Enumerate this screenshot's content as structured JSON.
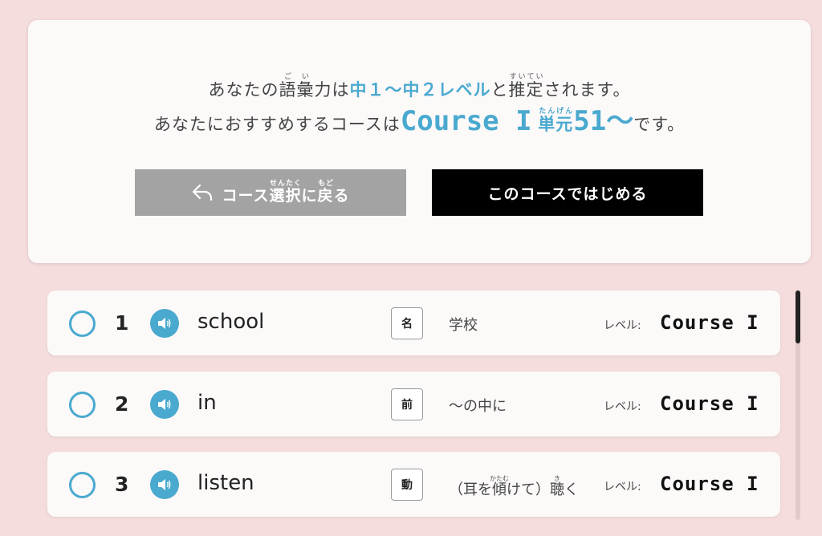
{
  "result": {
    "line1": {
      "pre": "あなたの",
      "kanji1": "語",
      "kanji1_ruby": "ご",
      "kanji2": "彙",
      "kanji2_ruby": "い",
      "mid": "力は",
      "level": "中１〜中２レベル",
      "post_pre": "と",
      "kanji3": "推定",
      "kanji3_ruby": "すいてい",
      "post": "されます。"
    },
    "line2": {
      "pre": "あなたにおすすめするコースは",
      "course": "Course I",
      "unit_kanji": "単元",
      "unit_ruby": "たんげん",
      "unit_num": "51〜",
      "post": "です。"
    }
  },
  "buttons": {
    "back": {
      "pre": "コース",
      "kanji1": "選択",
      "kanji1_ruby": "せんたく",
      "mid": "に",
      "kanji2": "戻",
      "kanji2_ruby": "もど",
      "post": "る"
    },
    "start": "このコースではじめる"
  },
  "words": [
    {
      "num": "1",
      "word": "school",
      "pos": "名",
      "meaning": "学校",
      "level_label": "レベル:",
      "level": "Course I"
    },
    {
      "num": "2",
      "word": "in",
      "pos": "前",
      "meaning": "〜の中に",
      "level_label": "レベル:",
      "level": "Course I"
    },
    {
      "num": "3",
      "word": "listen",
      "pos": "動",
      "meaning_pre": "（耳を",
      "meaning_k1": "傾",
      "meaning_k1_ruby": "かたむ",
      "meaning_mid": "けて）",
      "meaning_k2": "聴",
      "meaning_k2_ruby": "き",
      "meaning_post": "く",
      "level_label": "レベル:",
      "level": "Course I"
    }
  ],
  "colors": {
    "accent": "#4aa9cf",
    "background": "#f5dcdd",
    "card": "#fcf9f9",
    "back_button": "#a3a3a3",
    "start_button": "#000000"
  },
  "icons": {
    "checkbox": "circle-outline-icon",
    "speaker": "speaker-icon",
    "back": "reply-arrow-icon"
  }
}
